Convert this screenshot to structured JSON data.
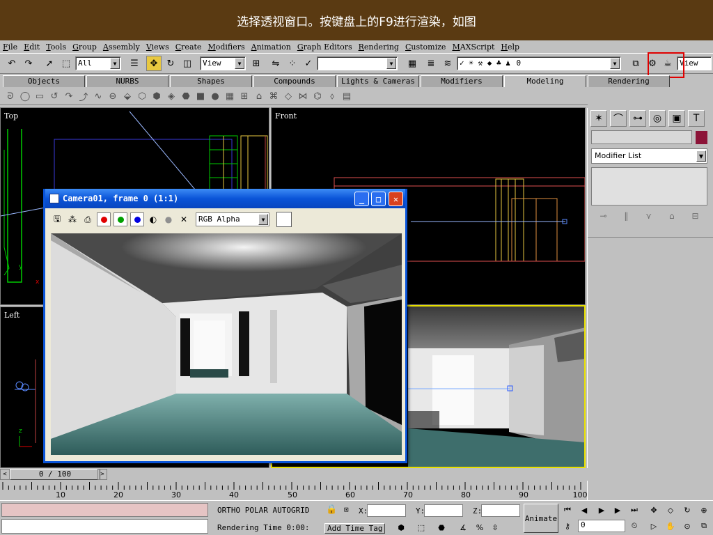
{
  "banner": {
    "text": "选择透视窗口。按键盘上的F9进行渲染，如图"
  },
  "menu": [
    "File",
    "Edit",
    "Tools",
    "Group",
    "Assembly",
    "Views",
    "Create",
    "Modifiers",
    "Animation",
    "Graph Editors",
    "Rendering",
    "Customize",
    "MAXScript",
    "Help"
  ],
  "toolbar": {
    "selection_filter": "All",
    "ref_coord": "View",
    "named_selection": "",
    "layer_value": "0",
    "render_view": "View"
  },
  "tabs": [
    {
      "label": "Objects"
    },
    {
      "label": "NURBS"
    },
    {
      "label": "Shapes"
    },
    {
      "label": "Compounds"
    },
    {
      "label": "Lights & Cameras"
    },
    {
      "label": "Modifiers"
    },
    {
      "label": "Modeling"
    },
    {
      "label": "Rendering"
    }
  ],
  "viewports": {
    "top": "Top",
    "front": "Front",
    "left": "Left"
  },
  "command_panel": {
    "modifier_list": "Modifier List",
    "object_color": "#8c1438"
  },
  "render_window": {
    "title": "Camera01, frame 0 (1:1)",
    "channel": "RGB Alpha",
    "channel_colors": [
      "#e00000",
      "#00a000",
      "#0000e0"
    ]
  },
  "timeline": {
    "position": "0 / 100",
    "ticks": [
      "10",
      "20",
      "30",
      "40",
      "50",
      "60",
      "70",
      "80",
      "90",
      "100"
    ]
  },
  "status": {
    "modes": "ORTHO  POLAR  AUTOGRID",
    "x_label": "X:",
    "y_label": "Y:",
    "z_label": "Z:",
    "rendering_time": "Rendering Time  0:00:",
    "add_time_tag": "Add Time Tag",
    "animate": "Animate",
    "frame": "0"
  },
  "accent": {
    "highlight": "#e00000",
    "title_bar": "#0a54d8",
    "banner": "#5a3a12"
  }
}
